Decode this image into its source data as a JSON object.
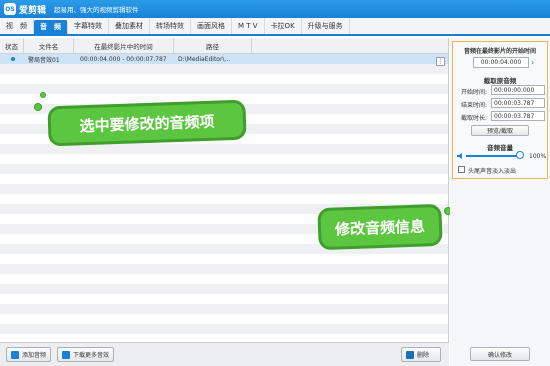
{
  "titlebar": {
    "logo_text": "OS",
    "app_name": "爱剪辑",
    "slogan": "超易用、强大的视频剪辑软件"
  },
  "tabs": [
    {
      "label": "视　频",
      "active": false
    },
    {
      "label": "音　频",
      "active": true
    },
    {
      "label": "字幕特效",
      "active": false
    },
    {
      "label": "叠加素材",
      "active": false
    },
    {
      "label": "转场特效",
      "active": false
    },
    {
      "label": "画面风格",
      "active": false
    },
    {
      "label": "M T V",
      "active": false
    },
    {
      "label": "卡拉OK",
      "active": false
    },
    {
      "label": "升级与服务",
      "active": false
    }
  ],
  "list": {
    "headers": [
      "状态",
      "文件名",
      "在最终影片中的时间",
      "路径"
    ],
    "rows": [
      {
        "name": "警局音效01",
        "time": "00:00:04.000 - 00:00:07.787",
        "path": "D:\\MediaEditor\\..."
      }
    ],
    "menu_glyph": "⋮"
  },
  "callouts": {
    "select": "选中要修改的音频项",
    "modify": "修改音频信息"
  },
  "bottom": {
    "add_audio": "添加音频",
    "download_more": "下载更多音效",
    "delete": "删除"
  },
  "right_panel": {
    "start_time_title": "音频在最终影片的开始时间",
    "start_time_value": "00:00:04.000",
    "clip_section": "截取原音频",
    "start_label": "开始时间:",
    "start_value": "00:00:00.000",
    "end_label": "结束时间:",
    "end_value": "00:00:03.787",
    "duration_label": "截取时长:",
    "duration_value": "00:00:03.787",
    "preview_button": "预览/截取",
    "volume_section": "音频音量",
    "volume_value": "100%",
    "volume_level": 1.0,
    "fade_label": "头尾声音淡入淡出",
    "confirm_button": "确认修改"
  },
  "colors": {
    "accent": "#1a82d6",
    "callout": "#5cc640",
    "panel_border": "#e8b84a"
  }
}
